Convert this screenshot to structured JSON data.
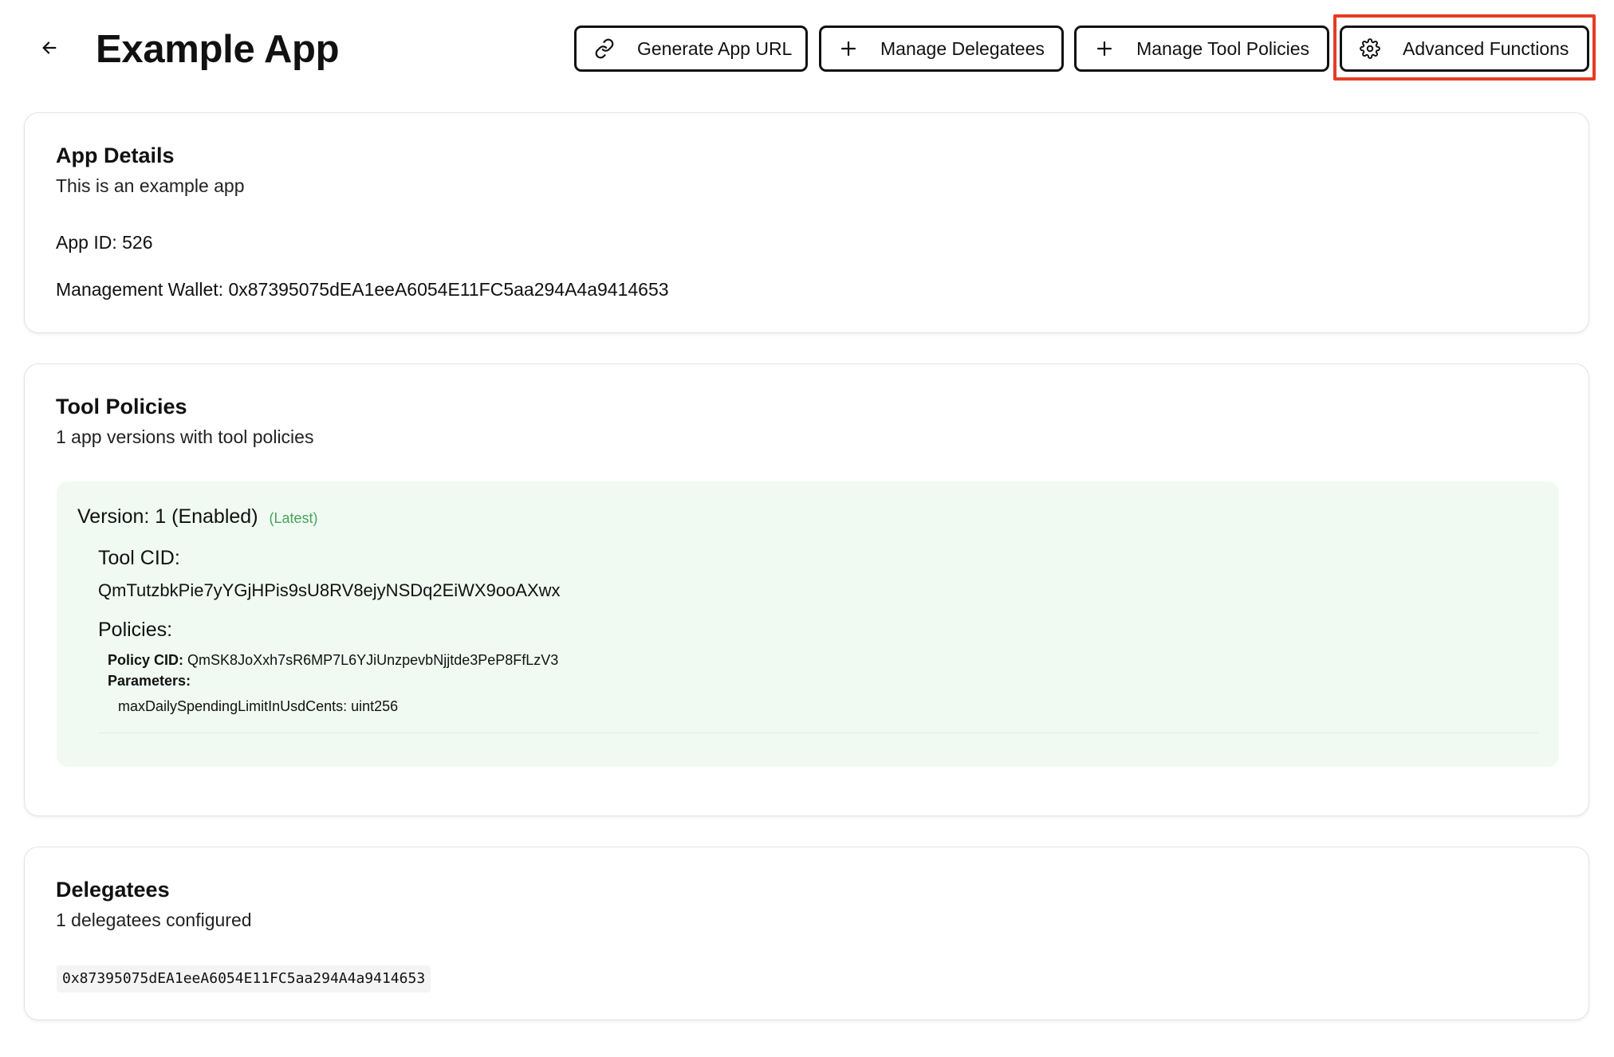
{
  "header": {
    "title": "Example App",
    "back_icon": "arrow-left-icon",
    "buttons": {
      "generate_url": {
        "label": "Generate App URL",
        "icon": "link-icon"
      },
      "manage_delegatees": {
        "label": "Manage Delegatees",
        "icon": "plus-icon"
      },
      "manage_tool_policies": {
        "label": "Manage Tool Policies",
        "icon": "plus-icon"
      },
      "advanced_functions": {
        "label": "Advanced Functions",
        "icon": "gear-icon"
      }
    },
    "highlight_color": "#e53c24"
  },
  "app_details": {
    "title": "App Details",
    "description": "This is an example app",
    "app_id_label": "App ID:",
    "app_id": "526",
    "wallet_label": "Management Wallet:",
    "wallet": "0x87395075dEA1eeA6054E11FC5aa294A4a9414653"
  },
  "tool_policies": {
    "title": "Tool Policies",
    "subtitle": "1 app versions with tool policies",
    "versions": [
      {
        "title": "Version: 1 (Enabled)",
        "latest_tag": "(Latest)",
        "tool_cid_label": "Tool CID:",
        "tool_cid": "QmTutzbkPie7yYGjHPis9sU8RV8ejyNSDq2EiWX9ooAXwx",
        "policies_label": "Policies:",
        "policy_cid_label": "Policy CID:",
        "policy_cid": "QmSK8JoXxh7sR6MP7L6YJiUnzpevbNjjtde3PeP8FfLzV3",
        "parameters_label": "Parameters:",
        "parameters": [
          {
            "name": "maxDailySpendingLimitInUsdCents",
            "type": "uint256",
            "text": "maxDailySpendingLimitInUsdCents: uint256"
          }
        ]
      }
    ],
    "box_color": "#f0faf3",
    "latest_color": "#46a35a"
  },
  "delegatees": {
    "title": "Delegatees",
    "subtitle": "1 delegatees configured",
    "addresses": [
      "0x87395075dEA1eeA6054E11FC5aa294A4a9414653"
    ]
  }
}
